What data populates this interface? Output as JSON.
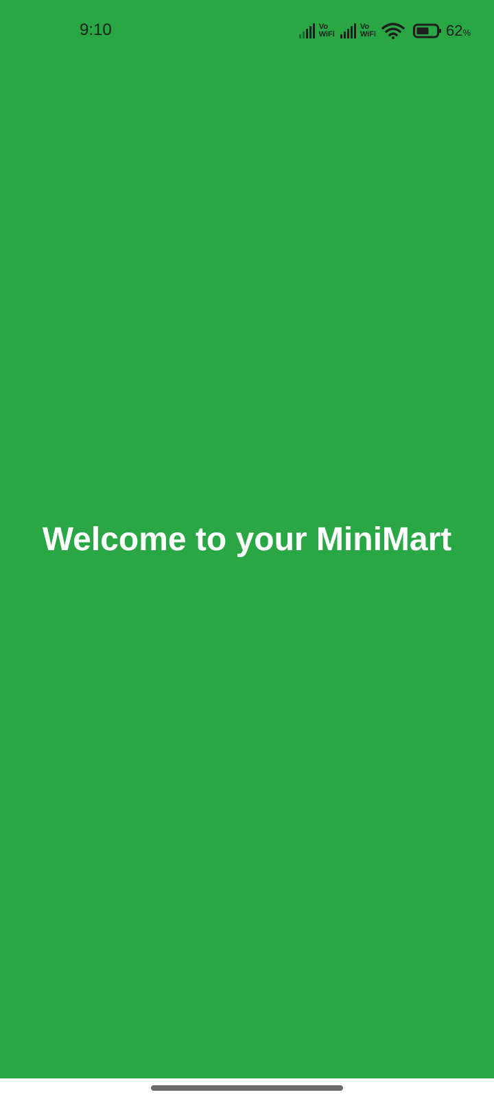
{
  "colors": {
    "background": "#29a745",
    "welcome_text": "#ffffff",
    "nav_bar": "#ffffff",
    "home_indicator": "#6b6b6b"
  },
  "status_bar": {
    "time": "9:10",
    "sim1_label_top": "Vo",
    "sim1_label_bottom": "WiFi",
    "sim2_label_top": "Vo",
    "sim2_label_bottom": "WiFi",
    "battery_value": "62",
    "battery_unit": "%",
    "icons": [
      "signal-icon",
      "signal-icon",
      "wifi-icon",
      "battery-icon"
    ]
  },
  "main": {
    "welcome_text": "Welcome to your MiniMart"
  }
}
